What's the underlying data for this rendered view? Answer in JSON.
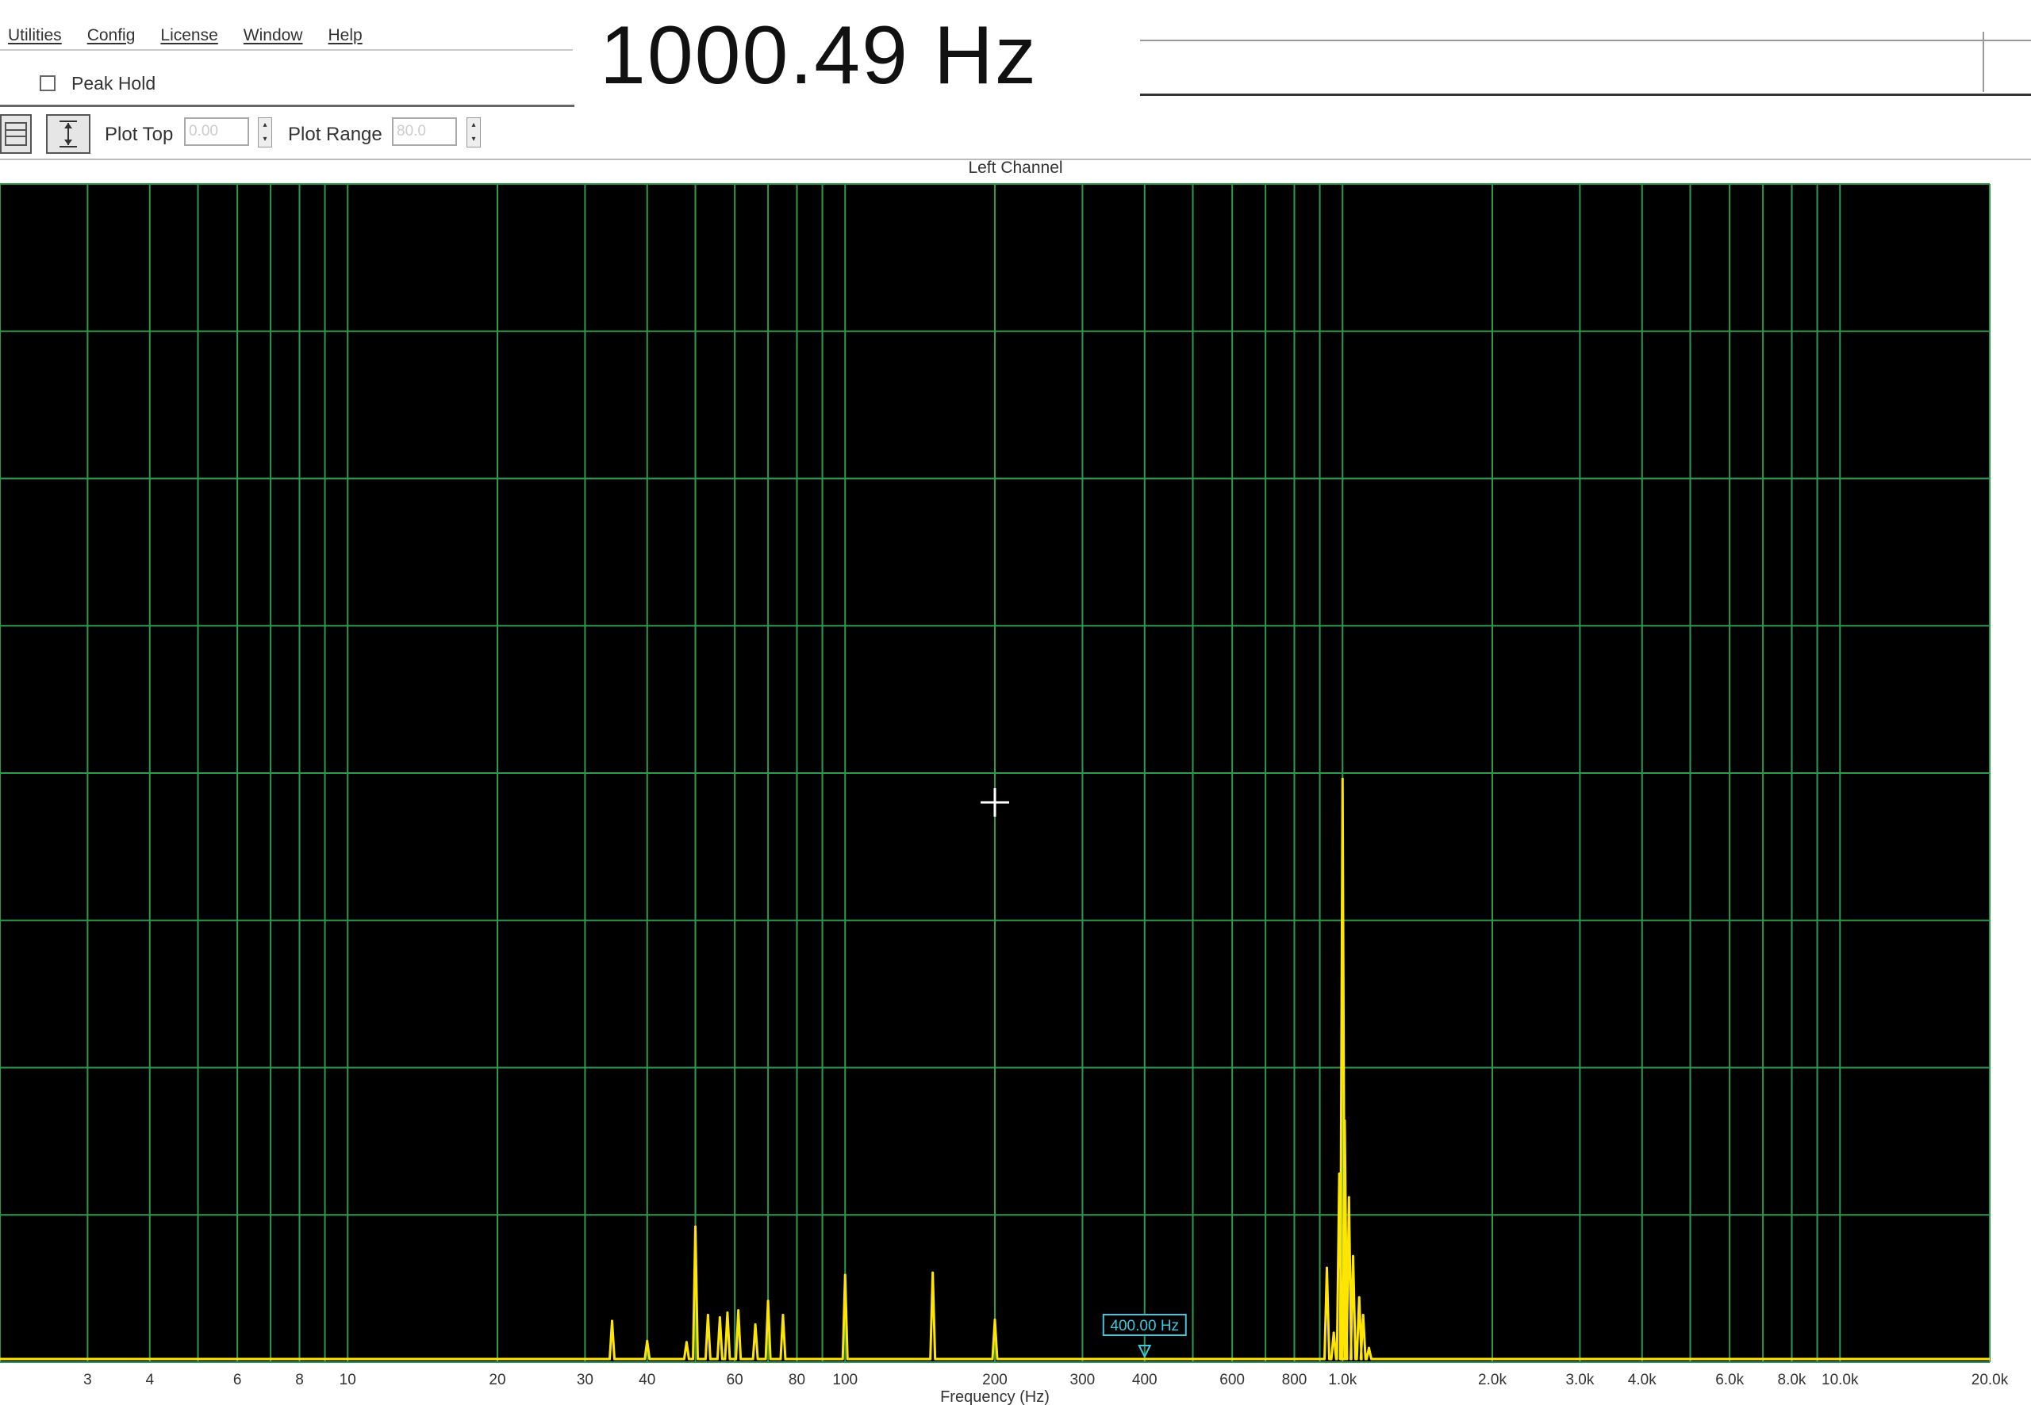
{
  "menu": {
    "items": [
      {
        "label": "Utilities",
        "name": "menu-utilities"
      },
      {
        "label": "Config",
        "name": "menu-config"
      },
      {
        "label": "License",
        "name": "menu-license"
      },
      {
        "label": "Window",
        "name": "menu-window"
      },
      {
        "label": "Help",
        "name": "menu-help"
      }
    ]
  },
  "peak_hold": {
    "label": "Peak Hold",
    "checked": false
  },
  "frequency_readout": "1000.49 Hz",
  "toolbar": {
    "plot_top_label": "Plot Top",
    "plot_top_value": "0.00",
    "plot_range_label": "Plot Range",
    "plot_range_value": "80.0"
  },
  "channel_title": "Left Channel",
  "colors": {
    "plot_background": "#000000",
    "grid": "#2f9b4a",
    "trace": "#ffe600",
    "marker": "#40c8e0"
  },
  "marker": {
    "label": "400.00 Hz",
    "frequency": 400
  },
  "chart_data": {
    "type": "line",
    "title": "Left Channel",
    "xlabel": "Frequency (Hz)",
    "ylabel": "",
    "x_scale": "log",
    "xlim": [
      2,
      20000
    ],
    "x_tick_labels": [
      {
        "value": 3,
        "label": "3"
      },
      {
        "value": 4,
        "label": "4"
      },
      {
        "value": 6,
        "label": "6"
      },
      {
        "value": 8,
        "label": "8"
      },
      {
        "value": 10,
        "label": "10"
      },
      {
        "value": 20,
        "label": "20"
      },
      {
        "value": 30,
        "label": "30"
      },
      {
        "value": 40,
        "label": "40"
      },
      {
        "value": 60,
        "label": "60"
      },
      {
        "value": 80,
        "label": "80"
      },
      {
        "value": 100,
        "label": "100"
      },
      {
        "value": 200,
        "label": "200"
      },
      {
        "value": 300,
        "label": "300"
      },
      {
        "value": 400,
        "label": "400"
      },
      {
        "value": 600,
        "label": "600"
      },
      {
        "value": 800,
        "label": "800"
      },
      {
        "value": 1000,
        "label": "1.0k"
      },
      {
        "value": 2000,
        "label": "2.0k"
      },
      {
        "value": 3000,
        "label": "3.0k"
      },
      {
        "value": 4000,
        "label": "4.0k"
      },
      {
        "value": 6000,
        "label": "6.0k"
      },
      {
        "value": 8000,
        "label": "8.0k"
      },
      {
        "value": 10000,
        "label": "10.0k"
      },
      {
        "value": 20000,
        "label": "20.0k"
      }
    ],
    "grid": true,
    "horizontal_divisions": 8,
    "ylim": [
      0,
      1
    ],
    "series": [
      {
        "points": [
          [
            34,
            0.035
          ],
          [
            40,
            0.018
          ],
          [
            48,
            0.017
          ],
          [
            50,
            0.115
          ],
          [
            53,
            0.04
          ],
          [
            56,
            0.038
          ],
          [
            58,
            0.042
          ],
          [
            61,
            0.044
          ],
          [
            66,
            0.032
          ],
          [
            70,
            0.052
          ],
          [
            75,
            0.04
          ],
          [
            100,
            0.074
          ],
          [
            150,
            0.076
          ],
          [
            200,
            0.036
          ],
          [
            930,
            0.08
          ],
          [
            960,
            0.025
          ],
          [
            985,
            0.16
          ],
          [
            1000,
            0.495
          ],
          [
            1010,
            0.205
          ],
          [
            1030,
            0.14
          ],
          [
            1050,
            0.09
          ],
          [
            1080,
            0.055
          ],
          [
            1100,
            0.04
          ],
          [
            1130,
            0.012
          ]
        ]
      }
    ]
  }
}
